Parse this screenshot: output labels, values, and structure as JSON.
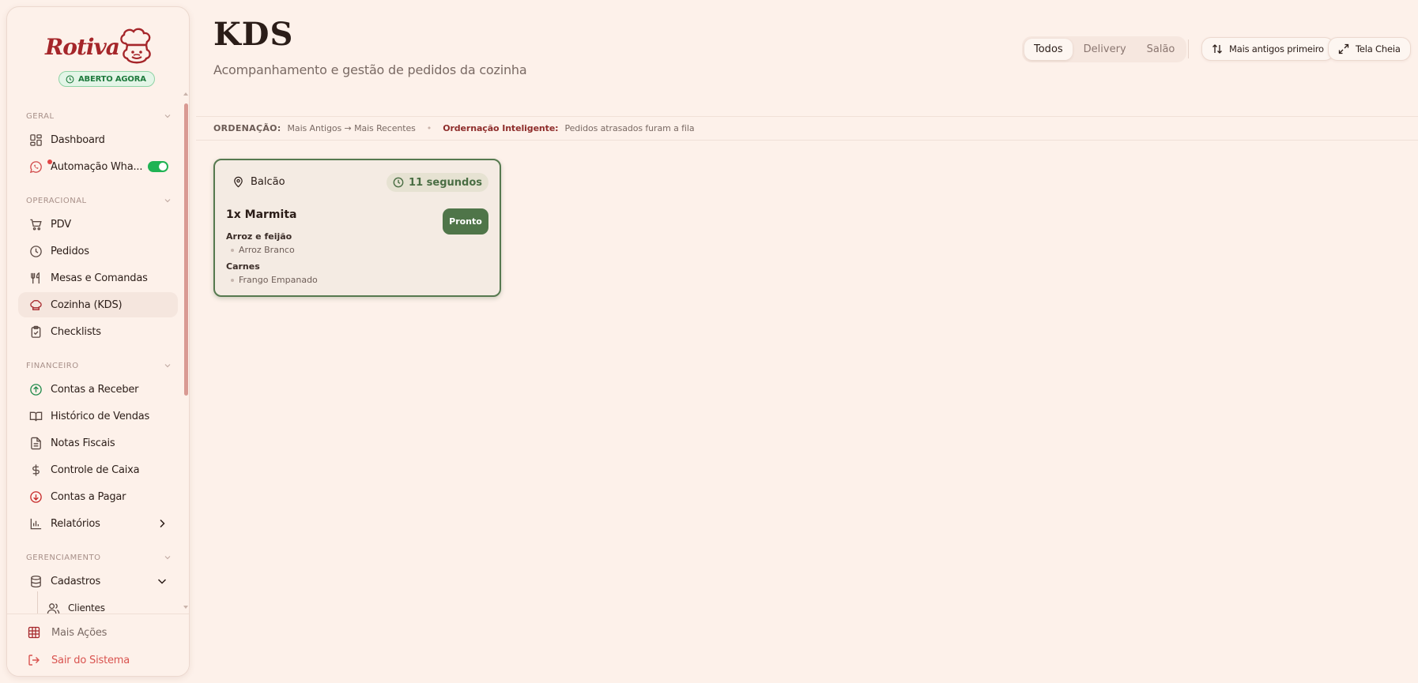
{
  "brand": {
    "name": "Rotiva",
    "status_badge": "ABERTO AGORA"
  },
  "sidebar": {
    "sections": [
      {
        "label": "GERAL"
      },
      {
        "label": "OPERACIONAL"
      },
      {
        "label": "FINANCEIRO"
      },
      {
        "label": "GERENCIAMENTO"
      }
    ],
    "items": {
      "dashboard": "Dashboard",
      "whatsapp": "Automação Wha...",
      "pdv": "PDV",
      "pedidos": "Pedidos",
      "mesas": "Mesas e Comandas",
      "cozinha": "Cozinha (KDS)",
      "checklists": "Checklists",
      "receber": "Contas a Receber",
      "historico": "Histórico de Vendas",
      "notas": "Notas Fiscais",
      "caixa": "Controle de Caixa",
      "pagar": "Contas a Pagar",
      "relatorios": "Relatórios",
      "cadastros": "Cadastros",
      "clientes": "Clientes"
    },
    "footer": {
      "more_actions": "Mais Ações",
      "logout": "Sair do Sistema"
    }
  },
  "header": {
    "title": "KDS",
    "subtitle": "Acompanhamento e gestão de pedidos da cozinha",
    "filters": [
      "Todos",
      "Delivery",
      "Salão"
    ],
    "active_filter": "Todos",
    "sort_button": "Mais antigos primeiro",
    "fullscreen_button": "Tela Cheia"
  },
  "ordering": {
    "label": "ORDENAÇÃO:",
    "value": "Mais Antigos → Mais Recentes",
    "smart_label": "Ordernação Inteligente:",
    "smart_value": "Pedidos atrasados furam a fila"
  },
  "orders": [
    {
      "location": "Balcão",
      "elapsed": "11 segundos",
      "item": "1x Marmita",
      "action": "Pronto",
      "groups": [
        {
          "name": "Arroz e feijão",
          "option": "Arroz Branco"
        },
        {
          "name": "Carnes",
          "option": "Frango Empanado"
        }
      ]
    }
  ],
  "colors": {
    "background": "#fdf1ea",
    "brand_red": "#a5262a",
    "card_border": "#56794f",
    "ready_button": "#4f7549",
    "toggle_on": "#20b354"
  }
}
